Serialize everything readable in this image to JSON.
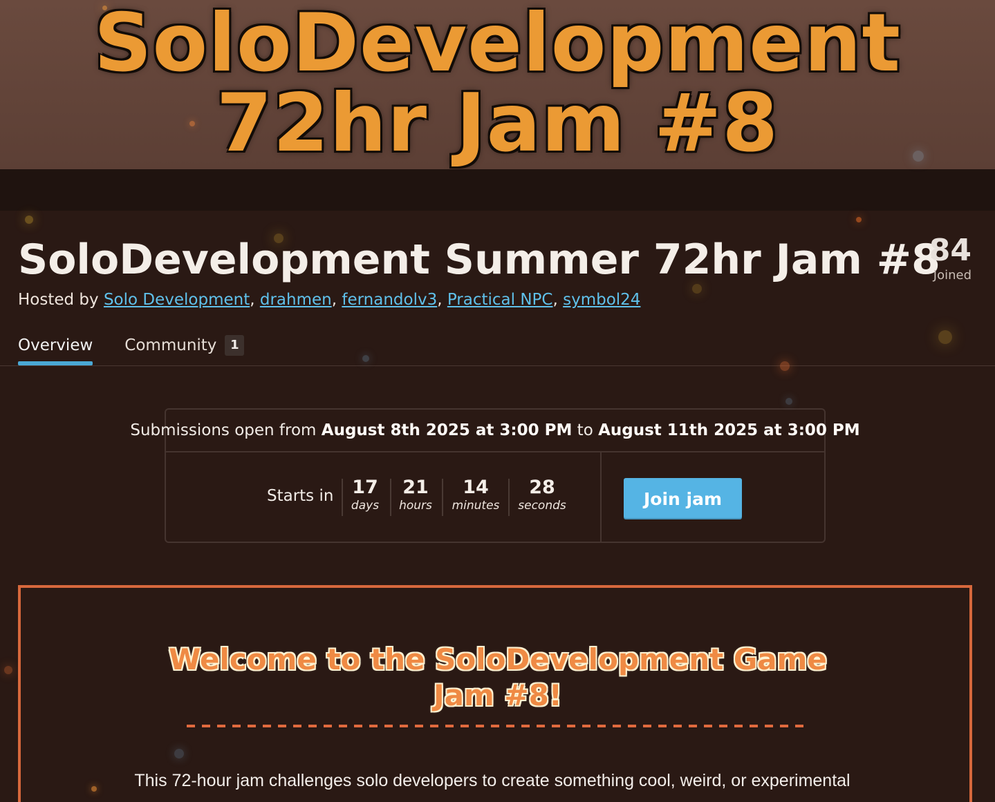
{
  "banner": {
    "line1": "SoloDevelopment",
    "line2": "72hr Jam #8"
  },
  "jam": {
    "title": "SoloDevelopment Summer 72hr Jam #8",
    "hosted_by_prefix": "Hosted by",
    "hosts": [
      "Solo Development",
      "drahmen",
      "fernandolv3",
      "Practical NPC",
      "symbol24"
    ],
    "joined_count": "84",
    "joined_label": "Joined"
  },
  "tabs": [
    {
      "label": "Overview",
      "active": true
    },
    {
      "label": "Community",
      "badge": "1",
      "active": false
    }
  ],
  "submission": {
    "prefix": "Submissions open from",
    "start": "August 8th 2025 at 3:00 PM",
    "to": "to",
    "end": "August 11th 2025 at 3:00 PM",
    "starts_in_label": "Starts in",
    "countdown": [
      {
        "value": "17",
        "label": "days"
      },
      {
        "value": "21",
        "label": "hours"
      },
      {
        "value": "14",
        "label": "minutes"
      },
      {
        "value": "28",
        "label": "seconds"
      }
    ],
    "join_label": "Join jam"
  },
  "welcome": {
    "title_line1": "Welcome to the SoloDevelopment Game",
    "title_line2": "Jam #8!",
    "text": "This 72-hour jam challenges solo developers to create something cool, weird, or experimental"
  },
  "colors": {
    "background": "#2a1914",
    "accent": "#55b4e4",
    "link": "#5fc0ea",
    "banner_text": "#eb9a34",
    "welcome_border": "#d7683c",
    "welcome_title": "#ef8a44"
  }
}
